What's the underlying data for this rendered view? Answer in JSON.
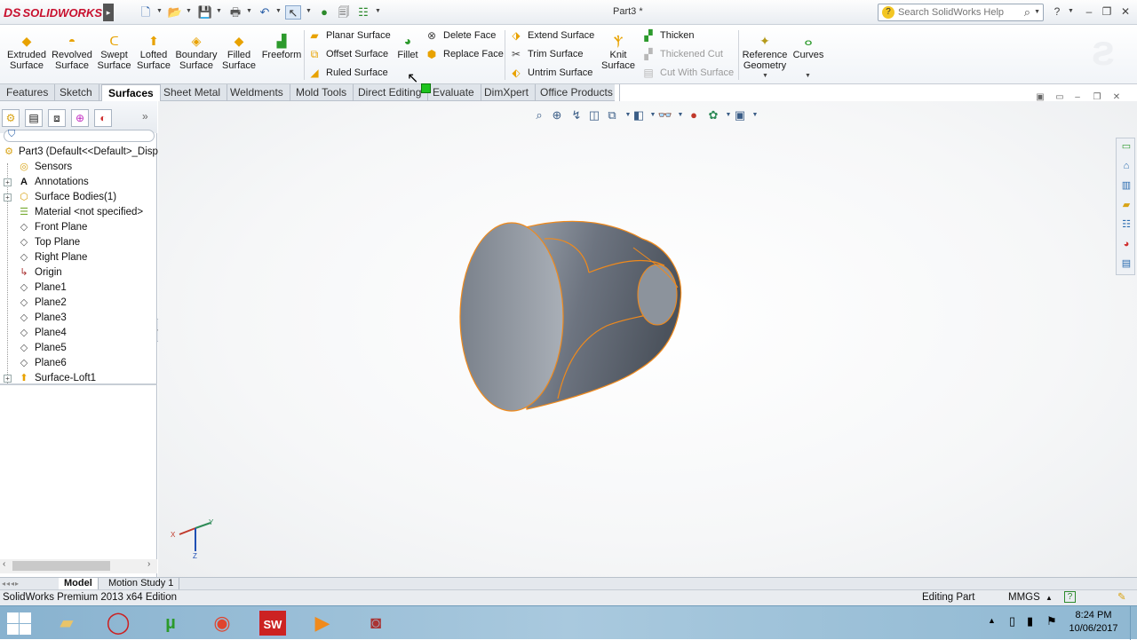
{
  "app": {
    "logo_text": "SOLIDWORKS",
    "logo_mark": "DS",
    "doc_title": "Part3 *"
  },
  "search": {
    "placeholder": "Search SolidWorks Help"
  },
  "commands": {
    "extruded": "Extruded Surface",
    "revolved": "Revolved Surface",
    "swept": "Swept Surface",
    "lofted": "Lofted Surface",
    "boundary": "Boundary Surface",
    "filled": "Filled Surface",
    "freeform": "Freeform",
    "planar": "Planar Surface",
    "offset": "Offset Surface",
    "ruled": "Ruled Surface",
    "fillet": "Fillet",
    "delete_face": "Delete Face",
    "replace_face": "Replace Face",
    "extend": "Extend Surface",
    "trim": "Trim Surface",
    "untrim": "Untrim Surface",
    "knit": "Knit Surface",
    "thicken": "Thicken",
    "thickened_cut": "Thickened Cut",
    "cut_with_surface": "Cut With Surface",
    "reference_geometry": "Reference Geometry",
    "curves": "Curves"
  },
  "tabs": [
    "Features",
    "Sketch",
    "Surfaces",
    "Sheet Metal",
    "Weldments",
    "Mold Tools",
    "Direct Editing",
    "Evaluate",
    "DimXpert",
    "Office Products"
  ],
  "tree": {
    "root": "Part3  (Default<<Default>_Disp",
    "items": [
      "Sensors",
      "Annotations",
      "Surface Bodies(1)",
      "Material <not specified>",
      "Front Plane",
      "Top Plane",
      "Right Plane",
      "Origin",
      "Plane1",
      "Plane2",
      "Plane3",
      "Plane4",
      "Plane5",
      "Plane6",
      "Surface-Loft1"
    ]
  },
  "triad": {
    "x": "X",
    "y": "Y",
    "z": "Z"
  },
  "bottom_tabs": [
    "Model",
    "Motion Study 1"
  ],
  "status": {
    "edition": "SolidWorks Premium 2013 x64 Edition",
    "mode": "Editing Part",
    "units": "MMGS"
  },
  "clock": {
    "time": "8:24 PM",
    "date": "10/06/2017"
  },
  "colors": {
    "accent_orange": "#e8a200",
    "model_edge": "#f08a1c",
    "model_body": "#6d7480",
    "logo_red": "#c8102e"
  }
}
